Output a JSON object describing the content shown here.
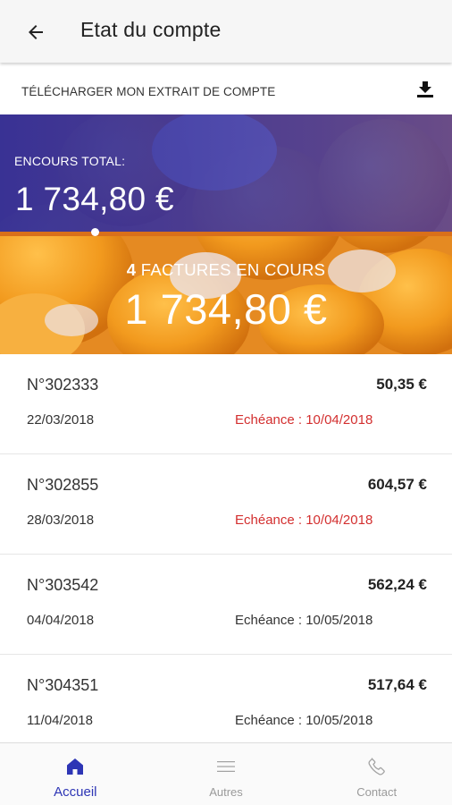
{
  "app_bar": {
    "title": "Etat du compte",
    "back_icon": "arrow-left-icon"
  },
  "download": {
    "label": "TÉLÉCHARGER MON EXTRAIT DE COMPTE",
    "icon": "download-icon"
  },
  "banner": {
    "encours_label": "ENCOURS TOTAL:",
    "encours_amount": "1 734,80 €",
    "factures_count": "4",
    "factures_label": "FACTURES EN COURS",
    "factures_amount": "1 734,80 €",
    "top_color": "#2f2fa6",
    "bottom_color": "#e8841c"
  },
  "invoices": [
    {
      "number": "N°302333",
      "amount": "50,35 €",
      "date": "22/03/2018",
      "due": "Echéance : 10/04/2018",
      "overdue": true
    },
    {
      "number": "N°302855",
      "amount": "604,57 €",
      "date": "28/03/2018",
      "due": "Echéance : 10/04/2018",
      "overdue": true
    },
    {
      "number": "N°303542",
      "amount": "562,24 €",
      "date": "04/04/2018",
      "due": "Echéance : 10/05/2018",
      "overdue": false
    },
    {
      "number": "N°304351",
      "amount": "517,64 €",
      "date": "11/04/2018",
      "due": "Echéance : 10/05/2018",
      "overdue": false
    }
  ],
  "nav": {
    "items": [
      {
        "label": "Accueil",
        "icon": "home-icon",
        "active": true
      },
      {
        "label": "Autres",
        "icon": "menu-icon",
        "active": false
      },
      {
        "label": "Contact",
        "icon": "phone-icon",
        "active": false
      }
    ],
    "active_color": "#2d35b5"
  }
}
